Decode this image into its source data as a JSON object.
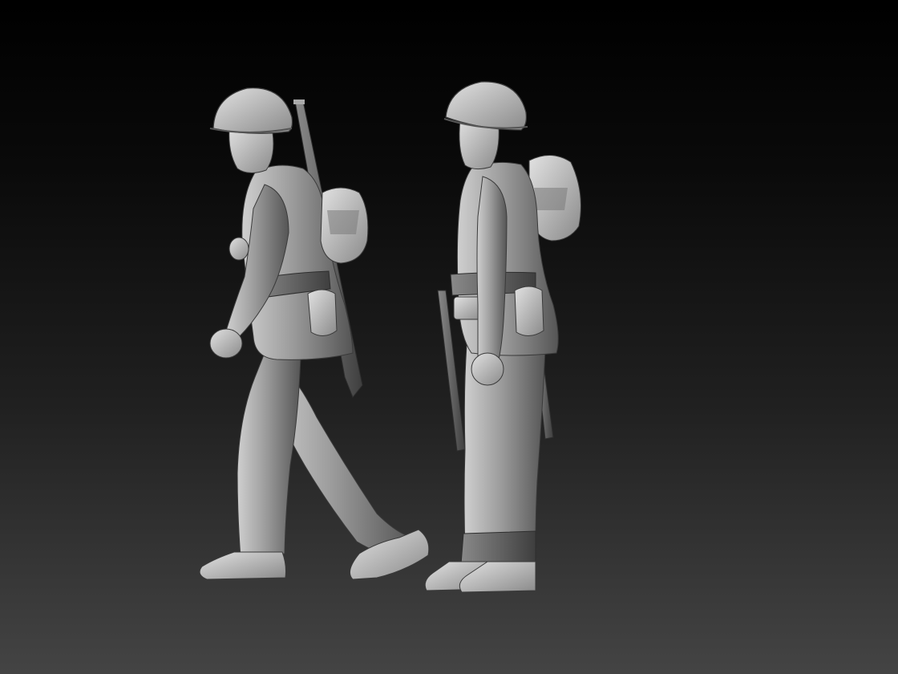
{
  "scene": {
    "background": {
      "top": "#000000",
      "bottom": "#444444"
    },
    "figure_color": "#9a9a9a",
    "figure_highlight": "#d0d0d0",
    "figure_shadow": "#3e3e3e",
    "figures": [
      {
        "name": "walking-soldier",
        "pose": "walking",
        "equipment": [
          "helmet",
          "rifle",
          "backpack",
          "canteen",
          "belt"
        ]
      },
      {
        "name": "standing-soldier",
        "pose": "standing",
        "equipment": [
          "helmet",
          "rifle",
          "backpack",
          "canteen",
          "belt"
        ]
      }
    ]
  }
}
